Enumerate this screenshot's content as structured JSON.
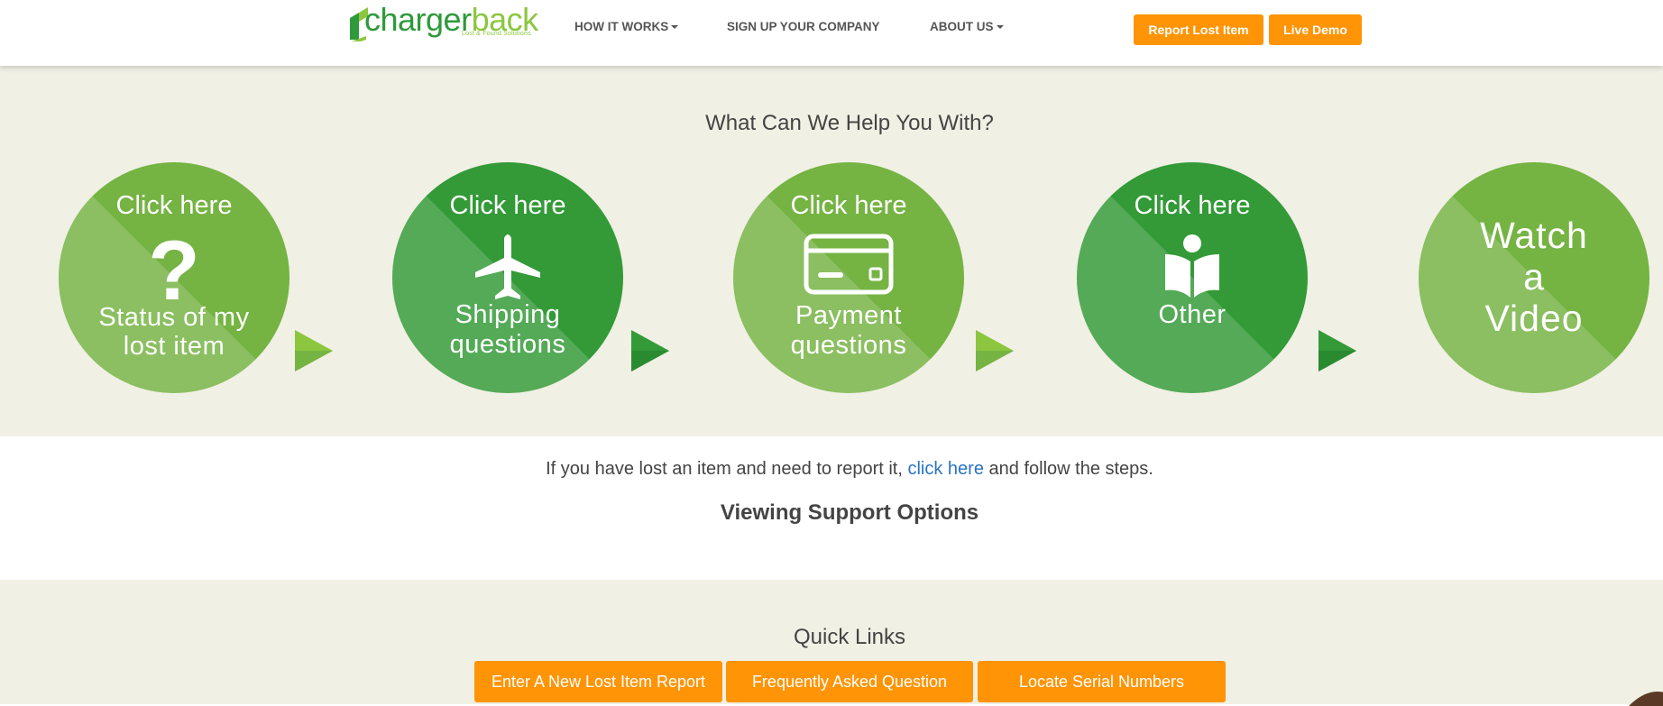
{
  "brand": {
    "name_part1": "charger",
    "name_part2": "back",
    "tagline": "Lost & Found Solutions",
    "colors": {
      "dark_green": "#2e9a3a",
      "light_green": "#8cc63f",
      "orange": "#ff9406"
    }
  },
  "nav": {
    "how_it_works": "HOW IT WORKS",
    "sign_up": "SIGN UP YOUR COMPANY",
    "about_us": "ABOUT US"
  },
  "header_buttons": {
    "report_lost_item": "Report Lost Item",
    "live_demo": "Live Demo"
  },
  "help": {
    "title": "What Can We Help You With?",
    "cards": [
      {
        "top": "Click here",
        "icon": "question-mark-icon",
        "line1": "Status of my",
        "line2": "lost item"
      },
      {
        "top": "Click here",
        "icon": "airplane-icon",
        "line1": "Shipping",
        "line2": "questions"
      },
      {
        "top": "Click here",
        "icon": "credit-card-icon",
        "line1": "Payment",
        "line2": "questions"
      },
      {
        "top": "Click here",
        "icon": "reader-book-icon",
        "line1": "Other"
      },
      {
        "video": [
          "Watch",
          "a",
          "Video"
        ]
      }
    ]
  },
  "info": {
    "before": "If you have lost an item and need to report it, ",
    "link": "click here",
    "after": " and follow the steps.",
    "support_title": "Viewing Support Options"
  },
  "quick_links": {
    "title": "Quick Links",
    "buttons": [
      "Enter A New Lost Item Report",
      "Frequently Asked Question",
      "Locate Serial Numbers"
    ]
  }
}
